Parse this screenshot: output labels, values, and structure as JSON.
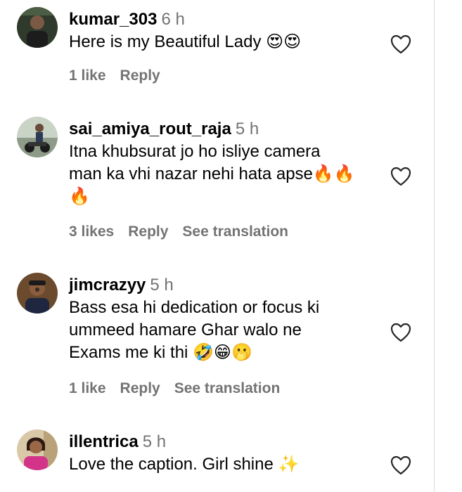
{
  "comments": [
    {
      "username": "kumar_303",
      "time": "6 h",
      "lines": [
        "Here is my Beautiful Lady 😍😍"
      ],
      "likes": "1 like",
      "reply": "Reply",
      "translation": ""
    },
    {
      "username": "sai_amiya_rout_raja",
      "time": "5 h",
      "lines": [
        "Itna khubsurat jo ho isliye camera",
        "man ka vhi nazar nehi hata apse🔥🔥",
        "🔥"
      ],
      "likes": "3 likes",
      "reply": "Reply",
      "translation": "See translation"
    },
    {
      "username": "jimcrazyy",
      "time": "5 h",
      "lines": [
        "Bass esa hi dedication or focus ki",
        "ummeed hamare Ghar walo ne",
        "Exams me ki thi 🤣😁🫢"
      ],
      "likes": "1 like",
      "reply": "Reply",
      "translation": "See translation"
    },
    {
      "username": "illentrica",
      "time": "5 h",
      "lines": [
        "Love the caption. Girl shine ✨"
      ],
      "likes": "",
      "reply": "",
      "translation": ""
    }
  ],
  "icons": {
    "like": "heart-outline-icon"
  },
  "colors": {
    "secondary_text": "#737373",
    "primary_text": "#000000",
    "divider": "#dbdbdb"
  }
}
